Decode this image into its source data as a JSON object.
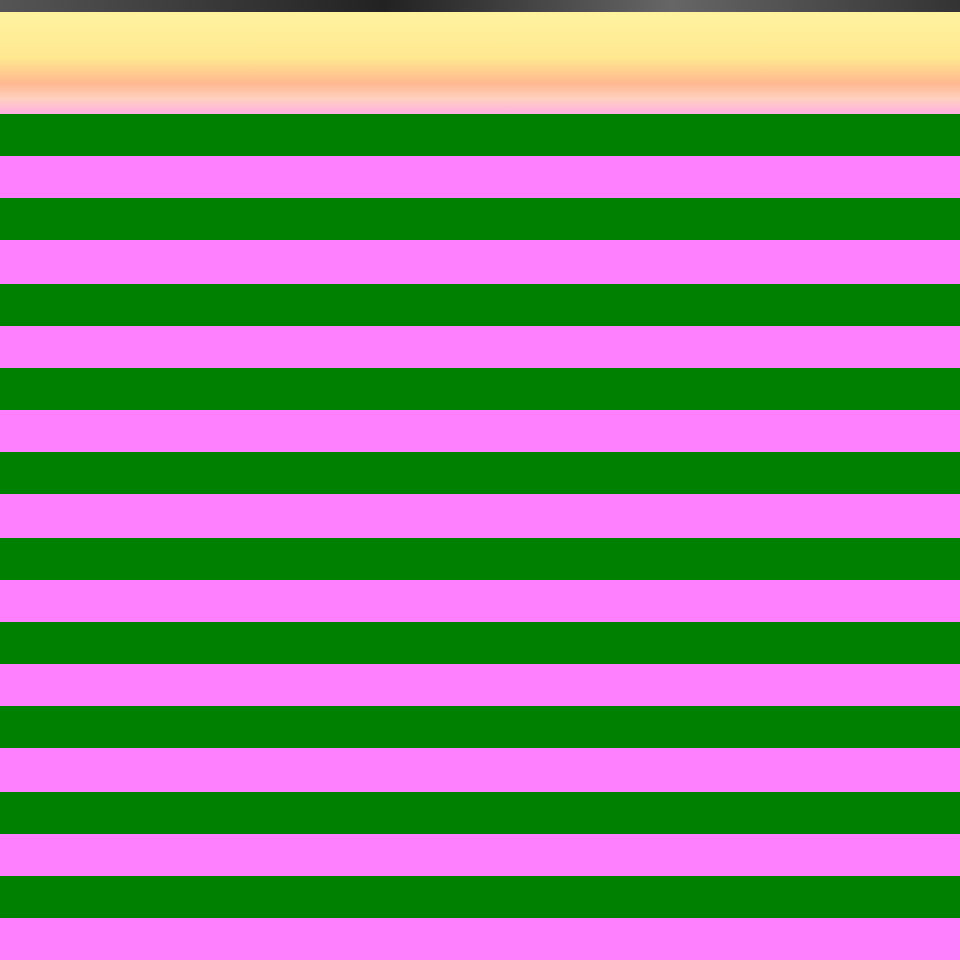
{
  "stripes": [
    {
      "color": "#008000"
    },
    {
      "color": "#ff80ff"
    },
    {
      "color": "#008000"
    },
    {
      "color": "#ff80ff"
    },
    {
      "color": "#008000"
    },
    {
      "color": "#ff80ff"
    },
    {
      "color": "#008000"
    },
    {
      "color": "#ff80ff"
    },
    {
      "color": "#008000"
    },
    {
      "color": "#ff80ff"
    },
    {
      "color": "#008000"
    },
    {
      "color": "#ff80ff"
    },
    {
      "color": "#008000"
    },
    {
      "color": "#ff80ff"
    },
    {
      "color": "#008000"
    },
    {
      "color": "#ff80ff"
    },
    {
      "color": "#008000"
    },
    {
      "color": "#ff80ff"
    },
    {
      "color": "#008000"
    },
    {
      "color": "#ff80ff"
    }
  ]
}
